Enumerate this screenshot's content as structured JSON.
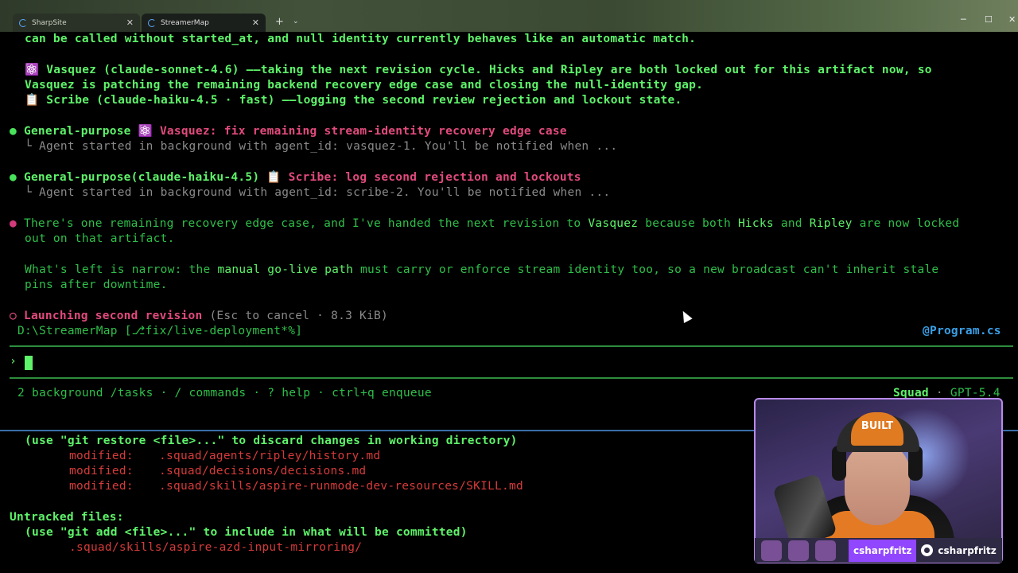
{
  "window": {
    "tabs": [
      {
        "label": "SharpSite",
        "active": false
      },
      {
        "label": "StreamerMap",
        "active": true
      }
    ],
    "new_tab": "+",
    "tab_dropdown": "⌄",
    "minimize": "─",
    "maximize": "☐",
    "close": "✕",
    "tab_close": "✕"
  },
  "terminal": {
    "line1": "can be called without started_at, and null identity currently behaves like an automatic match.",
    "vasquez_emoji": "⚛️",
    "vasquez_text": "Vasquez (claude-sonnet-4.6) ——taking the next revision cycle. Hicks and Ripley are both locked out for this artifact now, so",
    "vasquez_text2": "Vasquez is patching the remaining backend recovery edge case and closing the null-identity gap.",
    "scribe_emoji": "📋",
    "scribe_text": "Scribe (claude-haiku-4.5 · fast) ——logging the second review rejection and lockout state.",
    "bullet": "●",
    "gp1_label": "General-purpose",
    "gp1_emoji": "⚛️",
    "gp1_task": "Vasquez: fix remaining stream-identity recovery edge case",
    "gp1_sub": "└ Agent started in background with agent_id: vasquez-1. You'll be notified when ...",
    "gp2_label": "General-purpose(claude-haiku-4.5)",
    "gp2_emoji": "📋",
    "gp2_task": "Scribe: log second rejection and lockouts",
    "gp2_sub": "└ Agent started in background with agent_id: scribe-2. You'll be notified when ...",
    "msg1_a": "There's one remaining recovery edge case, and I've handed the next revision to ",
    "msg1_vasquez": "Vasquez",
    "msg1_b": " because both ",
    "msg1_hicks": "Hicks",
    "msg1_c": " and ",
    "msg1_ripley": "Ripley",
    "msg1_d": " are now locked",
    "msg1_e": "out on that artifact.",
    "msg2_a": "What's left is narrow: the ",
    "msg2_bold": "manual go-live path",
    "msg2_b": " must carry or enforce stream identity too, so a new broadcast can't inherit stale",
    "msg2_c": "pins after downtime.",
    "spinner": "○",
    "launch_text": "Launching second revision",
    "launch_meta": "(Esc to cancel · 8.3 KiB)",
    "path": "D:\\StreamerMap [⎇fix/live-deployment*%]",
    "file_ref": "@Program.cs",
    "prompt": "›",
    "status_left": "2 background /tasks · / commands · ? help · ctrl+q enqueue",
    "status_agent": "Squad",
    "status_sep": "·",
    "status_model": "GPT-5.4",
    "git_restore_hint": "(use \"git restore <file>...\" to discard changes in working directory)",
    "modified_label": "modified:",
    "modified_files": [
      ".squad/agents/ripley/history.md",
      ".squad/decisions/decisions.md",
      ".squad/skills/aspire-runmode-dev-resources/SKILL.md"
    ],
    "untracked_title": "Untracked files:",
    "git_add_hint": "(use \"git add <file>...\" to include in what will be committed)",
    "untracked_file": ".squad/skills/aspire-azd-input-mirroring/"
  },
  "webcam": {
    "cap_text": "BUILT",
    "handle_twitch": "csharpfritz",
    "handle_github": "csharpfritz"
  },
  "colors": {
    "green": "#5ef36a",
    "magenta": "#e24a7e",
    "red": "#d63a3a",
    "cyan": "#3aa0e8",
    "twitch": "#9146ff"
  }
}
